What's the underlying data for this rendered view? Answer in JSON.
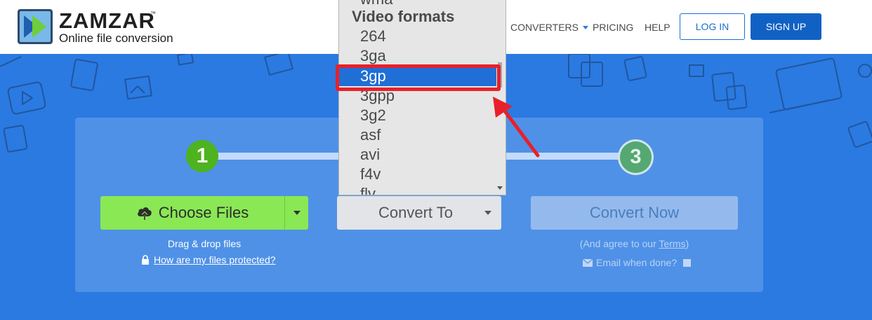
{
  "brand": {
    "name": "ZAMZAR",
    "tm": "™",
    "tagline": "Online file conversion",
    "logo_color": "#3a9be0"
  },
  "nav": {
    "converters": "CONVERTERS",
    "pricing": "PRICING",
    "help": "HELP",
    "login": "LOG IN",
    "signup": "SIGN UP"
  },
  "steps": {
    "step1": "1",
    "step3": "3"
  },
  "choose": {
    "label": "Choose Files",
    "drag_text": "Drag & drop files",
    "protected_link": "How are my files protected?"
  },
  "convert_to": {
    "label": "Convert To"
  },
  "convert_now": {
    "label": "Convert Now",
    "agree_prefix": "(And agree to our ",
    "terms_link": "Terms",
    "agree_suffix": ")",
    "email_label": "Email when done?"
  },
  "dropdown": {
    "partial_top": "wma",
    "group_label": "Video formats",
    "options": [
      "264",
      "3ga",
      "3gp",
      "3gpp",
      "3g2",
      "asf",
      "avi",
      "f4v",
      "flv"
    ],
    "selected": "3gp"
  },
  "colors": {
    "accent": "#1161c4",
    "hero_bg": "#2a7ae2",
    "choose_green": "#8ae855",
    "step1_green": "#4db31e",
    "highlight_red": "#e8202a"
  }
}
